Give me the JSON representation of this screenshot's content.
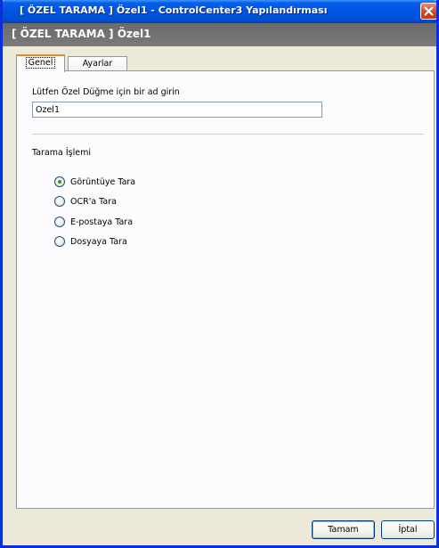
{
  "window": {
    "title": "[ ÖZEL TARAMA ] Özel1 - ControlCenter3 Yapılandırması"
  },
  "header": {
    "title": "[ ÖZEL TARAMA ] Özel1"
  },
  "tabs": [
    {
      "label": "Genel",
      "active": true
    },
    {
      "label": "Ayarlar",
      "active": false
    }
  ],
  "general": {
    "name_label": "Lütfen Özel Düğme için bir ad girin",
    "name_value": "Özel1",
    "group_label": "Tarama İşlemi",
    "options": [
      {
        "label": "Görüntüye Tara",
        "checked": true
      },
      {
        "label": "OCR'a Tara",
        "checked": false
      },
      {
        "label": "E-postaya Tara",
        "checked": false
      },
      {
        "label": "Dosyaya Tara",
        "checked": false
      }
    ]
  },
  "buttons": {
    "ok": "Tamam",
    "cancel": "İptal"
  },
  "icons": {
    "close": "close-icon"
  }
}
